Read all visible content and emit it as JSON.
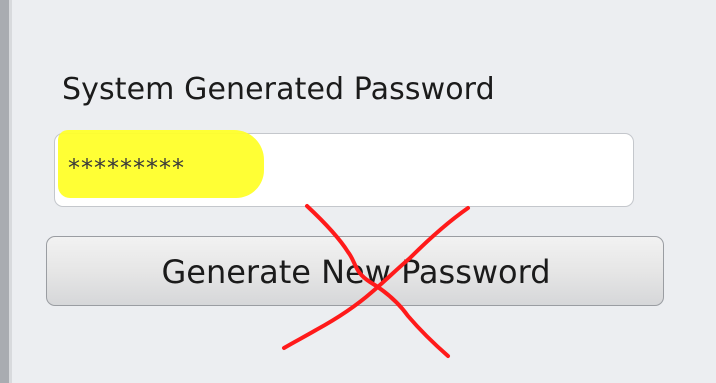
{
  "form": {
    "password_label": "System Generated Password",
    "password_value": "*********",
    "generate_button_label": "Generate New Password"
  },
  "annotations": {
    "highlight_color": "#ffff2a",
    "cross_color": "#ff1a1a"
  }
}
